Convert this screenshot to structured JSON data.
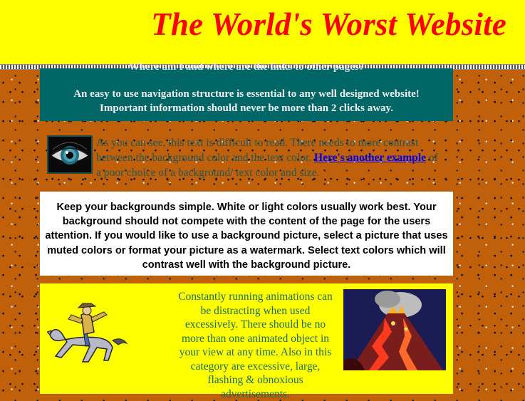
{
  "header": {
    "title": "The World's Worst Website"
  },
  "nav_box": {
    "cut_line": "Where am I and where are the links to other pages?",
    "line1": "An easy to use navigation structure is essential to any well designed website!",
    "line2": "Important information should never be more than 2 clicks away."
  },
  "low_contrast": {
    "text_before": "As you can see, this text is difficult to read. There needs to more contrast between the background color and the text color.",
    "link": "Here's another example",
    "text_after": "of a poor choice of a background/ text color and size."
  },
  "white_box": {
    "text": "Keep your backgrounds simple. White or light colors usually work best. Your background should not compete with the content of the page for the users attention. If you would like to use a background picture, select a picture that uses muted colors or format your picture as a watermark. Select text colors which will contrast well with the background picture."
  },
  "animation_box": {
    "text": "Constantly running animations can be distracting when used excessively. There should be no more than one animated object in your view at any time. Also in this category are excessive, large, flashing & obnoxious advertisements."
  },
  "icons": {
    "eye": "eye-icon",
    "cowboy": "cowboy-on-horse-icon",
    "volcano": "volcano-icon"
  },
  "colors": {
    "header_bg": "#ffff00",
    "title": "#ff0000",
    "page_bg": "#c0600a",
    "nav_bg": "#006666",
    "link": "#0000ee"
  }
}
